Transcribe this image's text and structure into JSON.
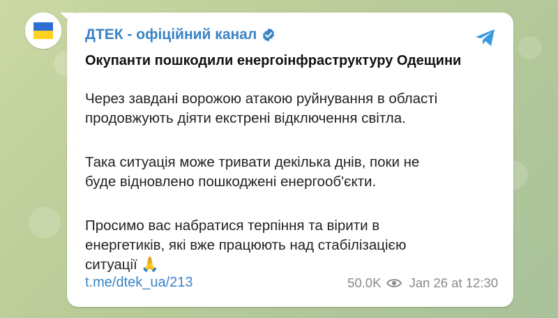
{
  "channel": {
    "name": "ДТЕК - офіційний канал",
    "avatar_colors": {
      "top": "#2f6fd4",
      "bottom": "#ffd21f"
    }
  },
  "post": {
    "title": "Окупанти пошкодили енергоінфраструктуру Одещини",
    "paragraphs": [
      "Через завдані ворожою атакою руйнування в області\nпродовжують діяти екстрені відключення світла.",
      "Така ситуація може тривати декілька днів, поки не\nбуде відновлено пошкоджені енергооб'єкти.",
      "Просимо вас набратися терпіння та вірити в\nенергетиків, які вже працюють над стабілізацією\nситуації 🙏"
    ],
    "link": "t.me/dtek_ua/213",
    "views": "50.0K",
    "date": "Jan 26 at 12:30"
  },
  "colors": {
    "accent": "#3a83c5",
    "meta": "#8a8a8a"
  },
  "icons": [
    "verified-icon",
    "share-icon",
    "eye-icon"
  ]
}
